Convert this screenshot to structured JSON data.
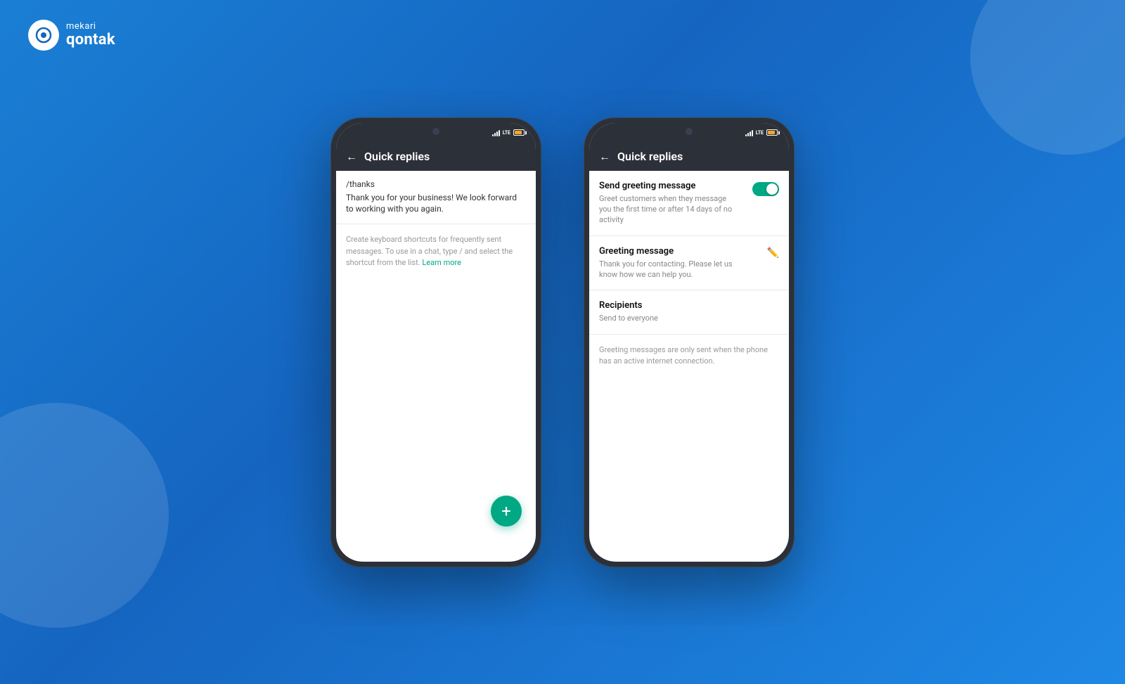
{
  "brand": {
    "mekari": "mekari",
    "qontak": "qontak"
  },
  "phone1": {
    "header": {
      "title": "Quick replies",
      "back": "←"
    },
    "quick_reply": {
      "shortcut": "/thanks",
      "message": "Thank you for your business! We look forward to working with you again."
    },
    "hint": {
      "text": "Create keyboard shortcuts for frequently sent messages. To use in a chat, type / and select the shortcut from the list.",
      "link_text": "Learn more"
    },
    "fab_label": "+"
  },
  "phone2": {
    "header": {
      "title": "Quick replies",
      "back": "←"
    },
    "send_greeting": {
      "label": "Send greeting message",
      "description": "Greet customers when they message you the first time or after 14 days of no activity",
      "toggle_on": true
    },
    "greeting_message": {
      "label": "Greeting message",
      "text": "Thank you for contacting. Please let us know how we can help you."
    },
    "recipients": {
      "label": "Recipients",
      "value": "Send to everyone"
    },
    "note": {
      "text": "Greeting messages are only sent when the phone has an active internet connection."
    }
  }
}
